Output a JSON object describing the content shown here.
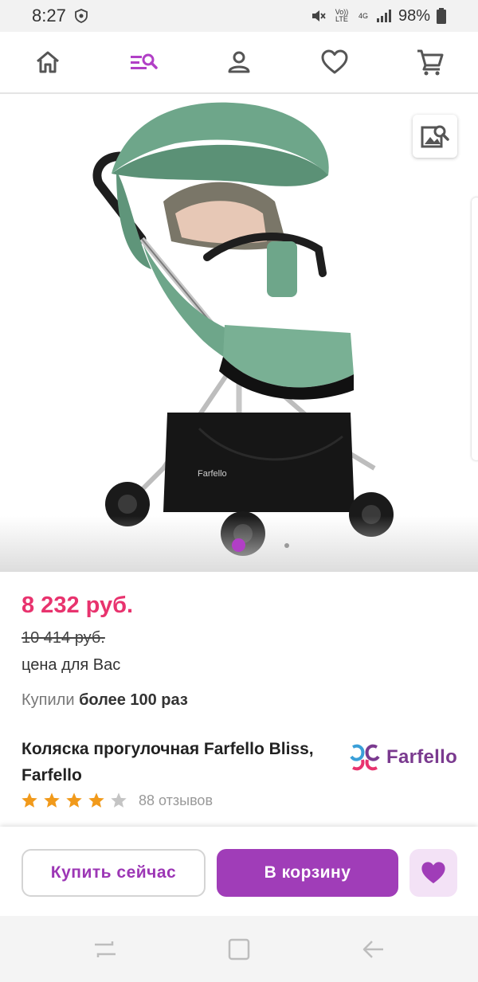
{
  "status_bar": {
    "time": "8:27",
    "battery": "98%",
    "volte_label": "Vo)) LTE",
    "network_label": "4G"
  },
  "nav": {
    "items": [
      "home-icon",
      "catalog-search-icon",
      "profile-icon",
      "favorites-icon",
      "cart-icon"
    ],
    "accent_color": "#b13fc6"
  },
  "product": {
    "price": "8 232 руб.",
    "old_price": "10 414 руб.",
    "price_note": "цена для Вас",
    "bought_prefix": "Купили",
    "bought_count": "более 100 раз",
    "title": "Коляска прогулочная Farfello Bliss, Farfello",
    "brand": "Farfello",
    "rating": 4,
    "rating_max": 5,
    "reviews": "88 отзывов",
    "stroller_color": "#6ea68a",
    "gallery_index": 1,
    "gallery_count": 2
  },
  "actions": {
    "buy_now": "Купить сейчас",
    "add_to_cart": "В корзину"
  },
  "colors": {
    "price": "#e8336e",
    "primary": "#a03db8",
    "star": "#f19a1b"
  }
}
